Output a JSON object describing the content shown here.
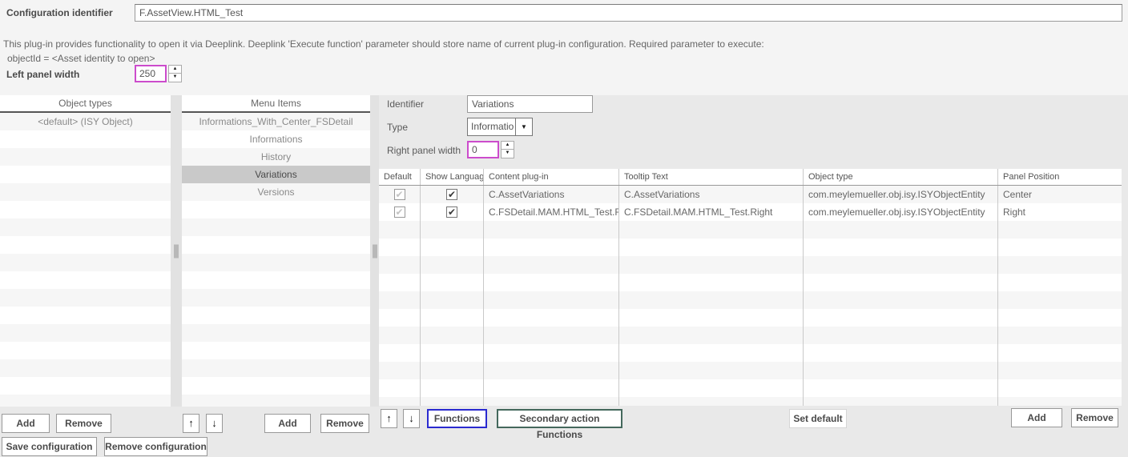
{
  "top": {
    "config_identifier_label": "Configuration identifier",
    "config_identifier_value": "F.AssetView.HTML_Test",
    "description_line1": "This plug-in provides functionality to open it via Deeplink. Deeplink 'Execute function' parameter should store name of current plug-in configuration. Required parameter to execute:",
    "description_line2": "objectId = <Asset identity to open>",
    "left_panel_width_label": "Left panel width",
    "left_panel_width_value": "250"
  },
  "object_types": {
    "header": "Object types",
    "items": [
      "<default> (ISY Object)"
    ],
    "add_label": "Add",
    "remove_label": "Remove"
  },
  "menu_items": {
    "header": "Menu Items",
    "items": [
      "Informations_With_Center_FSDetail",
      "Informations",
      "History",
      "Variations",
      "Versions"
    ],
    "selected": "Variations",
    "add_label": "Add",
    "remove_label": "Remove"
  },
  "detail": {
    "identifier_label": "Identifier",
    "identifier_value": "Variations",
    "type_label": "Type",
    "type_value": "Information",
    "right_panel_width_label": "Right panel width",
    "right_panel_width_value": "0"
  },
  "table": {
    "columns": [
      "Default",
      "Show Language",
      "Content plug-in",
      "Tooltip Text",
      "Object type",
      "Panel Position"
    ],
    "rows": [
      {
        "default_checked": true,
        "show_language_checked": true,
        "content_plugin": "C.AssetVariations",
        "tooltip_text": "C.AssetVariations",
        "object_type": "com.meylemueller.obj.isy.ISYObjectEntity",
        "panel_position": "Center"
      },
      {
        "default_checked": true,
        "show_language_checked": true,
        "content_plugin": "C.FSDetail.MAM.HTML_Test.Right",
        "tooltip_text": "C.FSDetail.MAM.HTML_Test.Right",
        "object_type": "com.meylemueller.obj.isy.ISYObjectEntity",
        "panel_position": "Right"
      }
    ],
    "functions_label": "Functions",
    "secondary_functions_label": "Secondary action Functions",
    "set_default_label": "Set default",
    "add_label": "Add",
    "remove_label": "Remove"
  },
  "footer": {
    "save_label": "Save configuration",
    "remove_label": "Remove configuration"
  },
  "icons": {
    "up_arrow": "↑",
    "down_arrow": "↓",
    "spin_up": "▲",
    "spin_down": "▼",
    "dropdown_arrow": "▼",
    "check": "✔"
  },
  "colors": {
    "accent_magenta": "#cc4ccc",
    "functions_border": "#2a2ad0",
    "secondary_border": "#44685c",
    "selected_row": "#c9c9c9"
  }
}
